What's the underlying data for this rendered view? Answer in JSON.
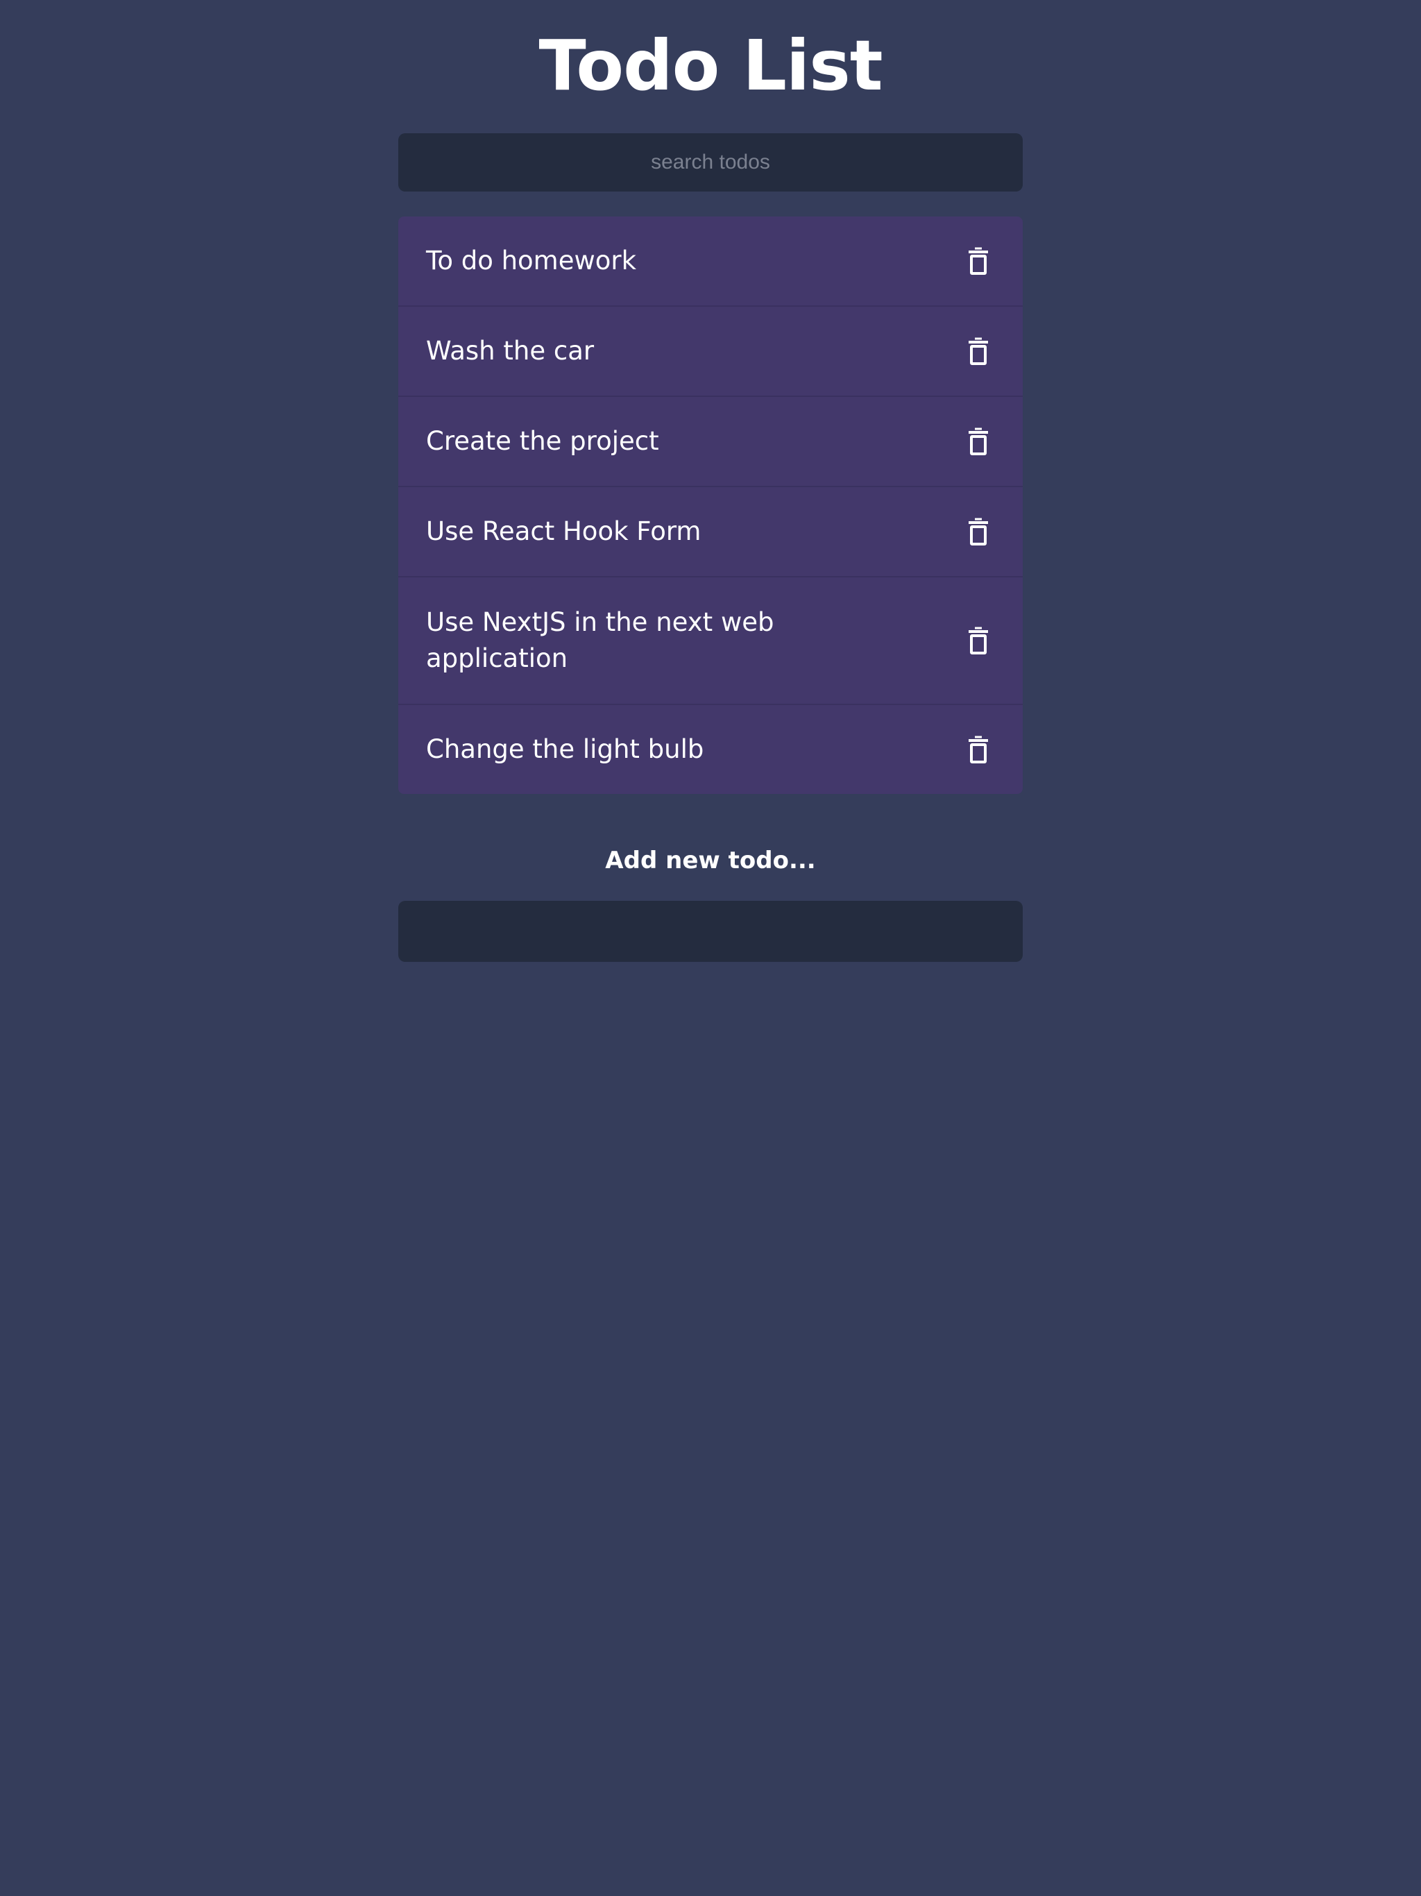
{
  "header": {
    "title": "Todo List"
  },
  "search": {
    "placeholder": "search todos",
    "value": ""
  },
  "todos": [
    {
      "text": "To do homework",
      "icon": "trash-icon"
    },
    {
      "text": "Wash the car",
      "icon": "trash-icon"
    },
    {
      "text": "Create the project",
      "icon": "trash-icon"
    },
    {
      "text": "Use React Hook Form",
      "icon": "trash-icon"
    },
    {
      "text": "Use NextJS in the next web application",
      "icon": "trash-icon"
    },
    {
      "text": "Change the light bulb",
      "icon": "trash-icon"
    }
  ],
  "add_form": {
    "label": "Add new todo...",
    "value": ""
  },
  "colors": {
    "background": "#353d5b",
    "input_background": "#242c3f",
    "todo_background": "#43386b",
    "text": "#ffffff",
    "placeholder": "#7b8190"
  }
}
